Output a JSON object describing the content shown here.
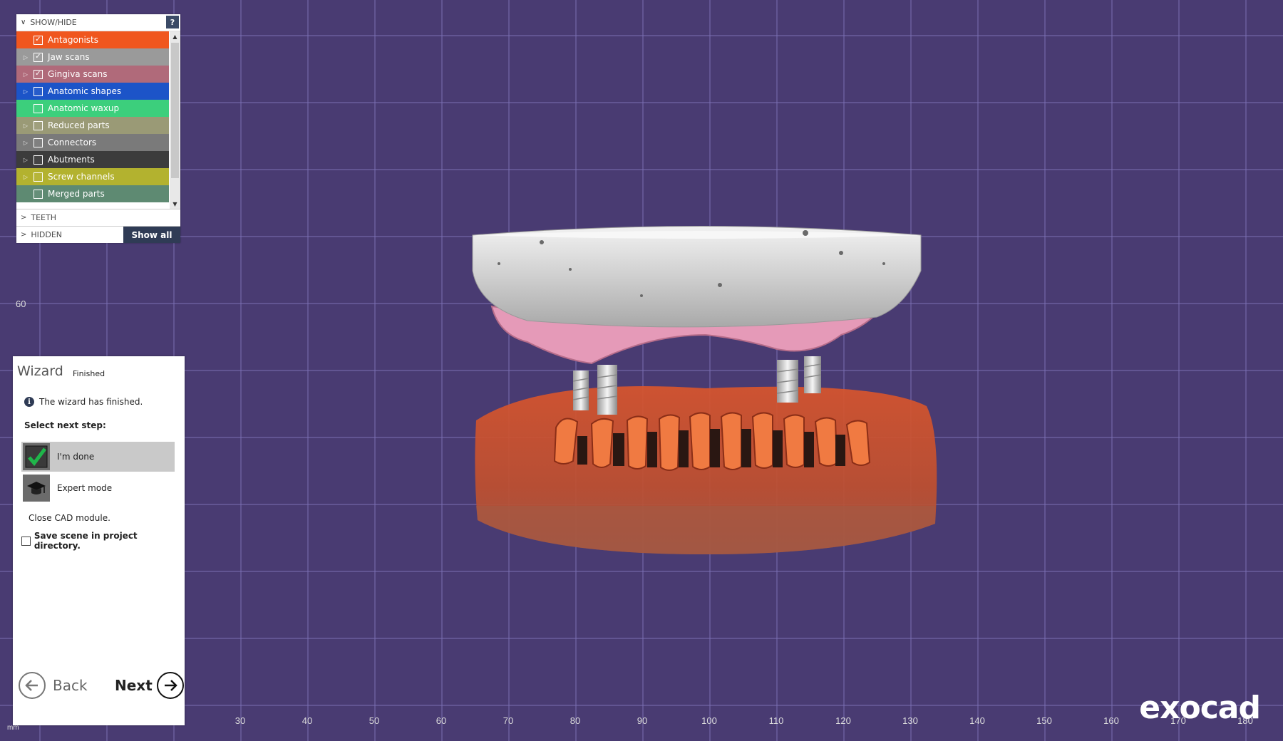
{
  "showhide": {
    "title": "SHOW/HIDE",
    "help_label": "?",
    "layers": [
      {
        "label": "Antagonists",
        "checked": true,
        "expandable": false,
        "color": "#f0561e"
      },
      {
        "label": "Jaw scans",
        "checked": true,
        "expandable": true,
        "color": "#9a9a9a"
      },
      {
        "label": "Gingiva scans",
        "checked": true,
        "expandable": true,
        "color": "#b06a7a"
      },
      {
        "label": "Anatomic shapes",
        "checked": false,
        "expandable": true,
        "color": "#1c54c8"
      },
      {
        "label": "Anatomic waxup",
        "checked": false,
        "expandable": false,
        "color": "#3ccf7c"
      },
      {
        "label": "Reduced parts",
        "checked": false,
        "expandable": true,
        "color": "#9a9a76"
      },
      {
        "label": "Connectors",
        "checked": false,
        "expandable": true,
        "color": "#7a7a7a"
      },
      {
        "label": "Abutments",
        "checked": false,
        "expandable": true,
        "color": "#3c3c3c"
      },
      {
        "label": "Screw channels",
        "checked": false,
        "expandable": true,
        "color": "#b3b22f"
      },
      {
        "label": "Merged parts",
        "checked": false,
        "expandable": false,
        "color": "#5e8a72"
      }
    ],
    "teeth_label": "TEETH",
    "hidden_label": "HIDDEN",
    "show_all_label": "Show all"
  },
  "wizard": {
    "title": "Wizard",
    "status": "Finished",
    "info": "The wizard has finished.",
    "select_label": "Select next step:",
    "options": [
      {
        "label": "I'm done",
        "icon": "checkmark-icon",
        "selected": true
      },
      {
        "label": "Expert mode",
        "icon": "graduation-cap-icon",
        "selected": false
      }
    ],
    "close_text": "Close CAD module.",
    "save_label": "Save scene in project directory.",
    "back_label": "Back",
    "next_label": "Next"
  },
  "axis": {
    "x_ticks": [
      "30",
      "40",
      "50",
      "60",
      "70",
      "80",
      "90",
      "100",
      "110",
      "120",
      "130",
      "140",
      "150",
      "160",
      "170",
      "180"
    ],
    "y_tick": "60",
    "unit": "mm"
  },
  "logo": "exocad",
  "colors": {
    "background": "#493b72",
    "grid": "#7b6fb3",
    "antagonist": "#f0561e",
    "gingiva": "#e59ab8",
    "jaw_scan": "#d4d4d4"
  }
}
